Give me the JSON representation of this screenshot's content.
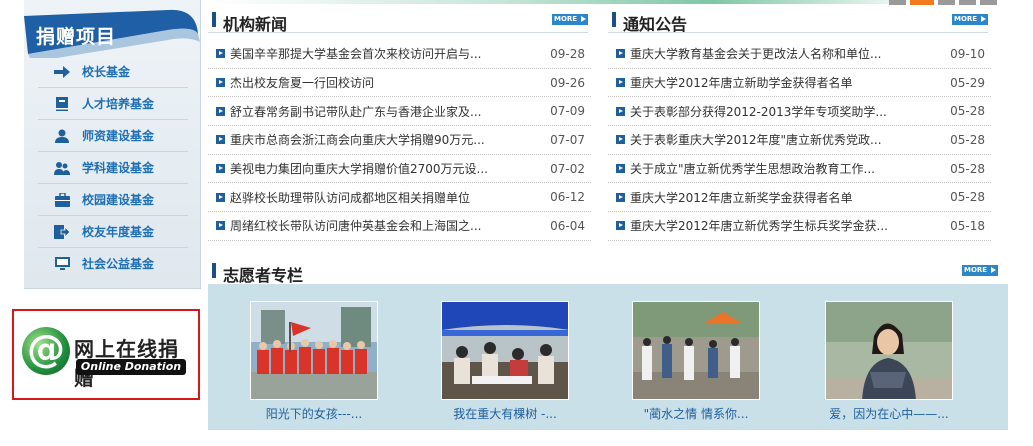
{
  "sidebar": {
    "title": "捐赠项目",
    "items": [
      {
        "label": "校长基金",
        "icon": "arrow-right-icon"
      },
      {
        "label": "人才培养基金",
        "icon": "book-icon"
      },
      {
        "label": "师资建设基金",
        "icon": "person-icon"
      },
      {
        "label": "学科建设基金",
        "icon": "people-icon"
      },
      {
        "label": "校园建设基金",
        "icon": "briefcase-icon"
      },
      {
        "label": "校友年度基金",
        "icon": "document-arrow-icon"
      },
      {
        "label": "社会公益基金",
        "icon": "monitor-icon"
      }
    ]
  },
  "donate": {
    "symbol": "@",
    "cn": "网上在线捐赠",
    "en": "Online Donation"
  },
  "news": {
    "title": "机构新闻",
    "more": "MORE",
    "items": [
      {
        "text": "美国辛辛那提大学基金会首次来校访问开启与...",
        "date": "09-28"
      },
      {
        "text": "杰出校友詹夏一行回校访问",
        "date": "09-26"
      },
      {
        "text": "舒立春常务副书记带队赴广东与香港企业家及...",
        "date": "07-09"
      },
      {
        "text": "重庆市总商会浙江商会向重庆大学捐赠90万元...",
        "date": "07-07"
      },
      {
        "text": "美视电力集团向重庆大学捐赠价值2700万元设...",
        "date": "07-02"
      },
      {
        "text": "赵骅校长助理带队访问成都地区相关捐赠单位",
        "date": "06-12"
      },
      {
        "text": "周绪红校长带队访问唐仲英基金会和上海国之...",
        "date": "06-04"
      }
    ]
  },
  "notice": {
    "title": "通知公告",
    "more": "MORE",
    "items": [
      {
        "text": "重庆大学教育基金会关于更改法人名称和单位...",
        "date": "09-10"
      },
      {
        "text": "重庆大学2012年唐立新助学金获得者名单",
        "date": "05-29"
      },
      {
        "text": "关于表彰部分获得2012-2013学年专项奖助学...",
        "date": "05-28"
      },
      {
        "text": "关于表彰重庆大学2012年度\"唐立新优秀党政...",
        "date": "05-28"
      },
      {
        "text": "关于成立\"唐立新优秀学生思想政治教育工作...",
        "date": "05-28"
      },
      {
        "text": "重庆大学2012年唐立新奖学金获得者名单",
        "date": "05-28"
      },
      {
        "text": "重庆大学2012年唐立新优秀学生标兵奖学金获...",
        "date": "05-18"
      }
    ]
  },
  "volunteer": {
    "title": "志愿者专栏",
    "more": "MORE",
    "items": [
      {
        "caption": "阳光下的女孩---..."
      },
      {
        "caption": "我在重大有棵树 -..."
      },
      {
        "caption": "\"蔺水之情 情系你..."
      },
      {
        "caption": "爱，因为在心中——..."
      }
    ]
  },
  "colors": {
    "accent": "#1e5f9c",
    "link": "#1f5fa0",
    "more_button": "#2d86c8",
    "donate_border": "#d71818",
    "volunteer_bg": "#c9e0e8"
  }
}
